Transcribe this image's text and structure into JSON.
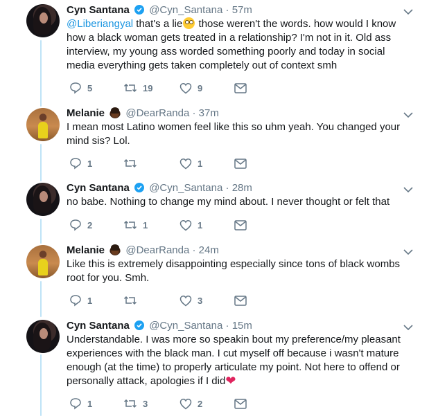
{
  "tweets": [
    {
      "author": "Cyn Santana",
      "handle": "@Cyn_Santana",
      "time": "57m",
      "verified": true,
      "mention": "@Liberiangyal",
      "text_before": " that's a lie",
      "text_after": " those weren't the words. how would I know how a black woman gets treated in a relationship? I'm not in it. Old ass interview, my young ass worded something poorly and today in social media everything gets taken completely out of context smh",
      "replies": "5",
      "retweets": "19",
      "likes": "9"
    },
    {
      "author": "Melanie",
      "handle": "@DearRanda",
      "time": "37m",
      "text": "I mean most Latino women feel like this so uhm yeah. You changed your mind sis? Lol.",
      "replies": "1",
      "retweets": "",
      "likes": "1"
    },
    {
      "author": "Cyn Santana",
      "handle": "@Cyn_Santana",
      "time": "28m",
      "verified": true,
      "text": "no babe. Nothing to change my mind about. I never thought or felt that",
      "replies": "2",
      "retweets": "1",
      "likes": "1"
    },
    {
      "author": "Melanie",
      "handle": "@DearRanda",
      "time": "24m",
      "text": "Like this is extremely disappointing especially since tons of black wombs root for you. Smh.",
      "replies": "1",
      "retweets": "",
      "likes": "3"
    },
    {
      "author": "Cyn Santana",
      "handle": "@Cyn_Santana",
      "time": "15m",
      "verified": true,
      "text": "Understandable. I was more so speakin bout my preference/my pleasant experiences with the black man. I cut myself off because i wasn't mature enough (at the time) to properly articulate my point. Not here to offend or personally attack, apologies if I did",
      "replies": "1",
      "retweets": "3",
      "likes": "2"
    }
  ],
  "separator": "·",
  "colors": {
    "link": "#1b95e0",
    "muted": "#657786",
    "thread": "#bfe3f7",
    "verified": "#1da1f2",
    "heart": "#e0245e"
  }
}
